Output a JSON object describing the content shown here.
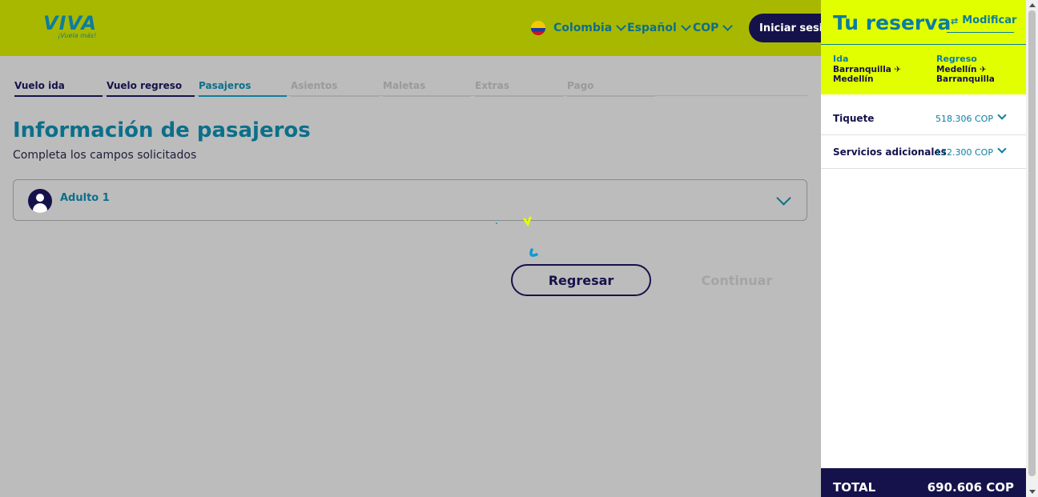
{
  "header": {
    "logo_text": "VIVA",
    "logo_tagline": "¡Vuela más!",
    "country": "Colombia",
    "language": "Español",
    "currency": "COP",
    "login_label": "Iniciar sesión"
  },
  "steps": [
    {
      "label": "Vuelo ida",
      "state": "done"
    },
    {
      "label": "Vuelo regreso",
      "state": "done"
    },
    {
      "label": "Pasajeros",
      "state": "active"
    },
    {
      "label": "Asientos",
      "state": "todo"
    },
    {
      "label": "Maletas",
      "state": "todo"
    },
    {
      "label": "Extras",
      "state": "todo"
    },
    {
      "label": "Pago",
      "state": "todo"
    }
  ],
  "main": {
    "title": "Información de pasajeros",
    "subtitle": "Completa los campos solicitados",
    "passenger_label": "Adulto 1",
    "back_label": "Regresar",
    "continue_label": "Continuar"
  },
  "summary": {
    "title": "Tu reserva",
    "modify_label": "Modificar",
    "outbound": {
      "label": "Ida",
      "from": "Barranquilla",
      "to": "Medellín"
    },
    "return": {
      "label": "Regreso",
      "from": "Medellín",
      "to": "Barranquilla"
    },
    "ticket": {
      "label": "Tiquete",
      "price": "518.306 COP"
    },
    "extras": {
      "label": "Servicios adicionales",
      "price": "172.300 COP"
    },
    "total_label": "TOTAL",
    "total_value": "690.606 COP"
  },
  "colors": {
    "header_bg": "#a8b800",
    "accent_yellow": "#e2ff00",
    "navy": "#15124b",
    "teal": "#0c7da0"
  }
}
